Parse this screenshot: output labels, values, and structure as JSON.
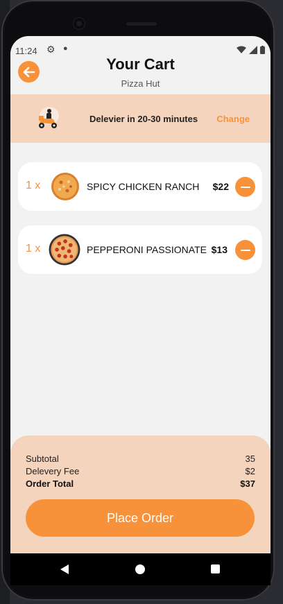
{
  "status": {
    "time": "11:24"
  },
  "header": {
    "title": "Your Cart",
    "restaurant": "Pizza Hut"
  },
  "delivery": {
    "text": "Delevier in 20-30 minutes",
    "change_label": "Change"
  },
  "cart": {
    "items": [
      {
        "qty": "1 x",
        "name": "SPICY CHICKEN RANCH",
        "price": "$22"
      },
      {
        "qty": "1 x",
        "name": "PEPPERONI PASSIONATE",
        "price": "$13"
      }
    ]
  },
  "summary": {
    "subtotal_label": "Subtotal",
    "subtotal_value": "35",
    "fee_label": "Delevery Fee",
    "fee_value": "$2",
    "total_label": "Order Total",
    "total_value": "$37",
    "place_order_label": "Place Order"
  },
  "colors": {
    "accent": "#f7923a",
    "panel": "#f4d4bd",
    "screen_bg": "#f2f2f2"
  },
  "icons": {
    "back": "arrow-left-icon",
    "remove": "minus-icon",
    "delivery": "scooter-icon",
    "status": [
      "gear-icon",
      "wifi-icon",
      "signal-icon",
      "battery-icon"
    ],
    "nav": [
      "back-triangle-icon",
      "home-circle-icon",
      "recents-square-icon"
    ]
  }
}
